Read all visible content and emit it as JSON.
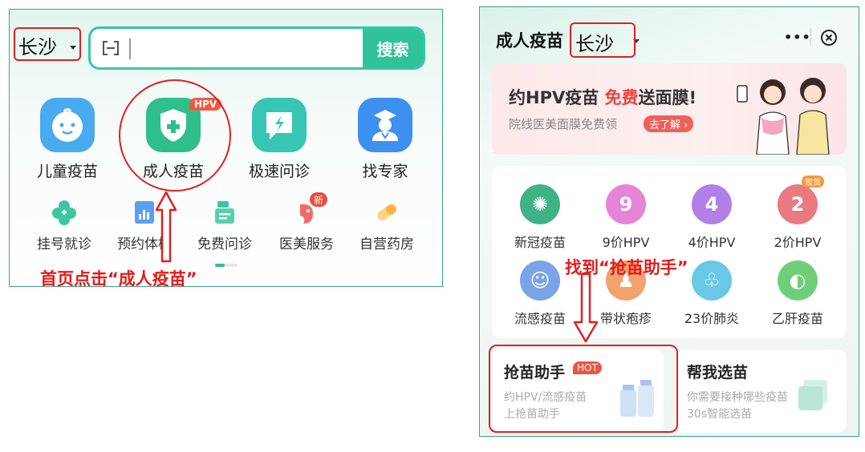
{
  "left": {
    "city": "长沙",
    "search_button": "搜索",
    "big_items": [
      {
        "label": "儿童疫苗",
        "icon": "baby-face-icon"
      },
      {
        "label": "成人疫苗",
        "icon": "shield-plus-icon",
        "badge": "HPV"
      },
      {
        "label": "极速问诊",
        "icon": "lightning-chat-icon"
      },
      {
        "label": "找专家",
        "icon": "doctor-icon"
      }
    ],
    "small_items": [
      {
        "label": "挂号就诊",
        "icon": "clover-icon"
      },
      {
        "label": "预约体检",
        "icon": "report-chart-icon"
      },
      {
        "label": "免费问诊",
        "icon": "doctor-card-icon"
      },
      {
        "label": "医美服务",
        "icon": "beauty-face-icon",
        "badge": "新"
      },
      {
        "label": "自营药房",
        "icon": "pill-icon"
      }
    ],
    "instruction": "首页点击“成人疫苗”"
  },
  "right": {
    "title": "成人疫苗",
    "city": "长沙",
    "more": "•••",
    "banner": {
      "title_a": "约HPV疫苗 ",
      "title_free": "免费",
      "title_b": "送面膜!",
      "subtitle": "院线医美面膜免费领",
      "button": "去了解 ›"
    },
    "grid": [
      {
        "label": "新冠疫苗",
        "color": "#3fb386",
        "glyph": "✺"
      },
      {
        "label": "9价HPV",
        "color": "#e684d8",
        "glyph": "9"
      },
      {
        "label": "4价HPV",
        "color": "#b17fe8",
        "glyph": "4"
      },
      {
        "label": "2价HPV",
        "color": "#ea7a7f",
        "glyph": "2",
        "badge": "现货"
      },
      {
        "label": "流感疫苗",
        "color": "#7aa4e6",
        "glyph": "☺"
      },
      {
        "label": "带状疱疹",
        "color": "#f2a26f",
        "glyph": "♟"
      },
      {
        "label": "23价肺炎",
        "color": "#69c8e6",
        "glyph": "♧"
      },
      {
        "label": "乙肝疫苗",
        "color": "#6fcf79",
        "glyph": "◐"
      }
    ],
    "helper": {
      "title": "抢苗助手",
      "badge": "HOT",
      "line1": "约HPV/流感疫苗",
      "line2": "上抢苗助手"
    },
    "picker": {
      "title": "帮我选苗",
      "line1": "你需要接种哪些疫苗",
      "line2": "30s智能选苗"
    },
    "instruction": "找到“抢苗助手”"
  }
}
